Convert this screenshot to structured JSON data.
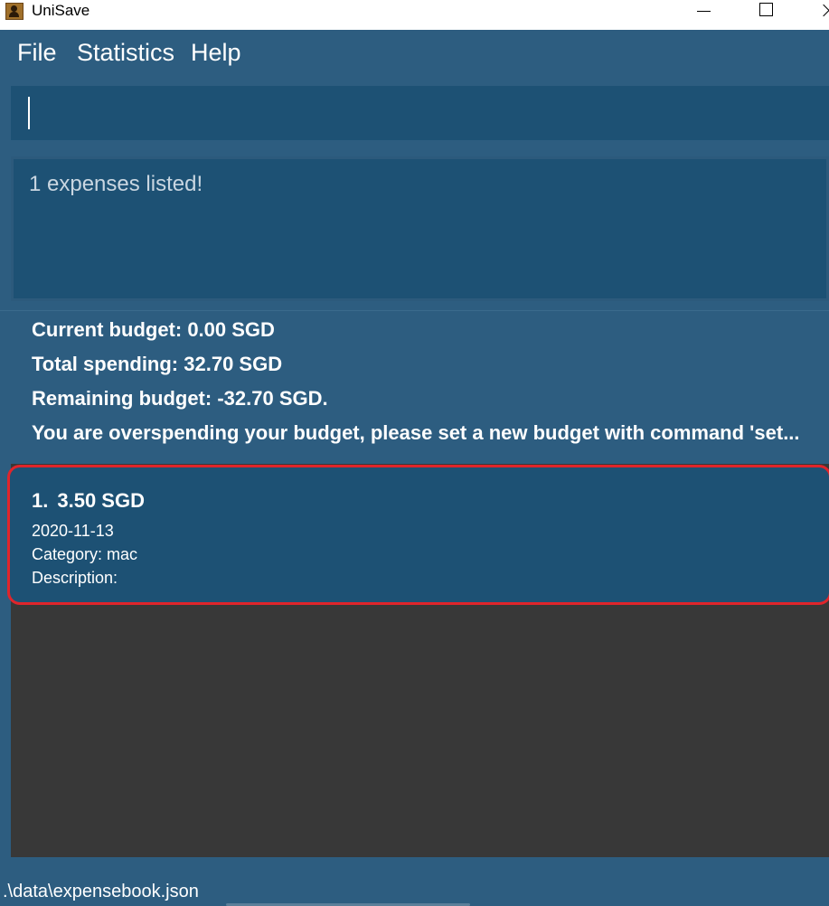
{
  "window": {
    "title": "UniSave"
  },
  "menu": {
    "file": "File",
    "statistics": "Statistics",
    "help": "Help"
  },
  "command": {
    "value": ""
  },
  "result": {
    "text": "1 expenses listed!"
  },
  "budget": {
    "current": "Current budget: 0.00 SGD",
    "total_spending": "Total spending: 32.70 SGD",
    "remaining": "Remaining budget: -32.70 SGD.",
    "warning": "You are overspending your budget, please set a new budget with command 'set..."
  },
  "expenses": [
    {
      "index": "1.",
      "amount": "3.50 SGD",
      "date": "2020-11-13",
      "category": "Category: mac",
      "description": "Description:"
    }
  ],
  "status": {
    "path": ".\\data\\expensebook.json"
  },
  "colors": {
    "panel": "#2d5d80",
    "box": "#1d5174",
    "list_background": "#383838",
    "highlight_border": "#e0252b"
  },
  "icons": {
    "app": "app-icon",
    "minimize": "minimize-icon",
    "maximize": "maximize-icon",
    "close": "close-icon"
  }
}
